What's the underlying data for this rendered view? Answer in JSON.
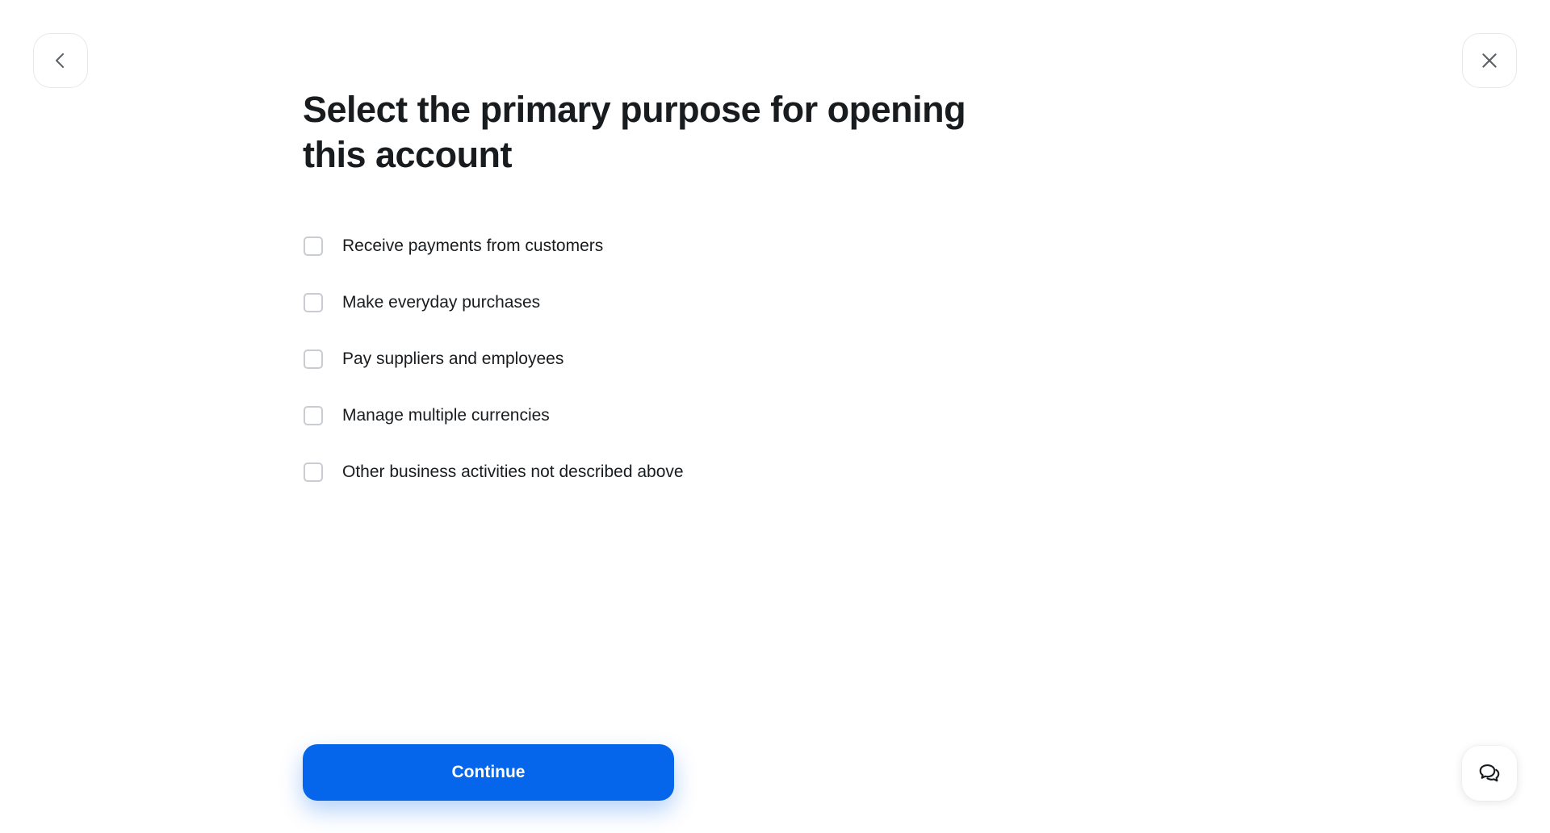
{
  "header": {
    "title": "Select the primary purpose for opening this account"
  },
  "options": [
    {
      "label": "Receive payments from customers",
      "checked": false
    },
    {
      "label": "Make everyday purchases",
      "checked": false
    },
    {
      "label": "Pay suppliers and employees",
      "checked": false
    },
    {
      "label": "Manage multiple currencies",
      "checked": false
    },
    {
      "label": "Other business activities not described above",
      "checked": false
    }
  ],
  "actions": {
    "continue_label": "Continue"
  },
  "icons": {
    "back": "chevron-left-icon",
    "close": "close-icon",
    "chat": "chat-bubbles-icon"
  },
  "colors": {
    "accent": "#0666eb",
    "text": "#191c1f",
    "checkbox_border": "#c9ccd1"
  }
}
